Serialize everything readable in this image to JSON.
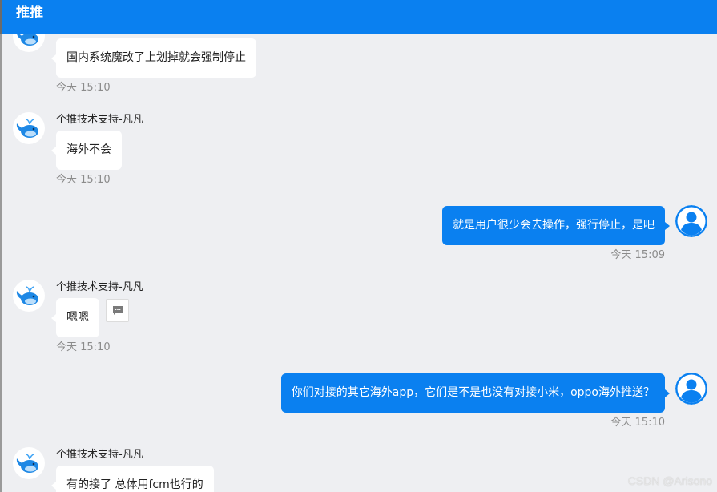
{
  "header": {
    "title": "推推"
  },
  "messages": [
    {
      "sender": "",
      "text": "国内系统魔改了上划掉就会强制停止",
      "time": "今天 15:10"
    },
    {
      "sender": "个推技术支持-凡凡",
      "text": "海外不会",
      "time": "今天 15:10"
    },
    {
      "sender": "",
      "text": "就是用户很少会去操作，强行停止，是吧",
      "time": "今天 15:09"
    },
    {
      "sender": "个推技术支持-凡凡",
      "text": "嗯嗯",
      "time": "今天 15:10"
    },
    {
      "sender": "",
      "text": "你们对接的其它海外app，它们是不是也没有对接小米，oppo海外推送？",
      "time": "今天 15:10"
    },
    {
      "sender": "个推技术支持-凡凡",
      "text": "有的接了 总体用fcm也行的",
      "time": ""
    }
  ],
  "watermark": "CSDN @Arisono",
  "colors": {
    "accent": "#0A80F0",
    "background": "#EEEFF2",
    "bubble_in": "#FFFFFF"
  },
  "icons": {
    "agent_avatar": "whale-icon",
    "user_avatar": "user-icon",
    "reply": "comment-icon"
  }
}
